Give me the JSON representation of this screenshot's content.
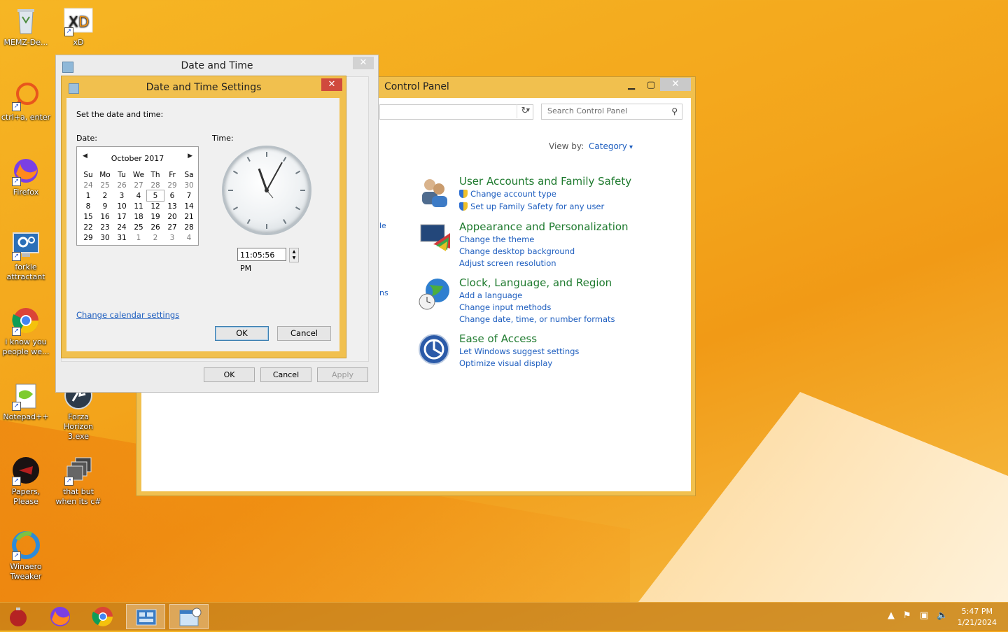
{
  "desktop": {
    "icons": [
      {
        "label": "MEMZ-De..."
      },
      {
        "label": "xD"
      },
      {
        "label": "ctrl+a, enter"
      },
      {
        "label": "Firefox"
      },
      {
        "label": "forkie attractant"
      },
      {
        "label": "i know you people we..."
      },
      {
        "label": "Notepad++"
      },
      {
        "label": "Forza Horizon 3.exe"
      },
      {
        "label": "Papers, Please"
      },
      {
        "label": "that but when its c#"
      },
      {
        "label": "Winaero Tweaker"
      }
    ]
  },
  "control_panel": {
    "title": "Control Panel",
    "search_placeholder": "Search Control Panel",
    "view_by_label": "View by:",
    "view_by_value": "Category",
    "peek_text_1": "le",
    "peek_text_2": "ns",
    "categories": [
      {
        "title": "User Accounts and Family Safety",
        "links": [
          "Change account type",
          "Set up Family Safety for any user"
        ]
      },
      {
        "title": "Appearance and Personalization",
        "links": [
          "Change the theme",
          "Change desktop background",
          "Adjust screen resolution"
        ]
      },
      {
        "title": "Clock, Language, and Region",
        "links": [
          "Add a language",
          "Change input methods",
          "Change date, time, or number formats"
        ]
      },
      {
        "title": "Ease of Access",
        "links": [
          "Let Windows suggest settings",
          "Optimize visual display"
        ]
      }
    ]
  },
  "date_time_dialog": {
    "title": "Date and Time",
    "ok_label": "OK",
    "cancel_label": "Cancel",
    "apply_label": "Apply"
  },
  "settings_dialog": {
    "title": "Date and Time Settings",
    "instruction": "Set the date and time:",
    "date_label": "Date:",
    "time_label": "Time:",
    "month_label": "October 2017",
    "weekdays": [
      "Su",
      "Mo",
      "Tu",
      "We",
      "Th",
      "Fr",
      "Sa"
    ],
    "weeks": [
      [
        "24",
        "25",
        "26",
        "27",
        "28",
        "29",
        "30"
      ],
      [
        "1",
        "2",
        "3",
        "4",
        "5",
        "6",
        "7"
      ],
      [
        "8",
        "9",
        "10",
        "11",
        "12",
        "13",
        "14"
      ],
      [
        "15",
        "16",
        "17",
        "18",
        "19",
        "20",
        "21"
      ],
      [
        "22",
        "23",
        "24",
        "25",
        "26",
        "27",
        "28"
      ],
      [
        "29",
        "30",
        "31",
        "1",
        "2",
        "3",
        "4"
      ]
    ],
    "selected_day": "5",
    "time_value": "11:05:56 PM",
    "calendar_link": "Change calendar settings",
    "ok_label": "OK",
    "cancel_label": "Cancel"
  },
  "taskbar": {
    "time": "5:47 PM",
    "date": "1/21/2024"
  }
}
